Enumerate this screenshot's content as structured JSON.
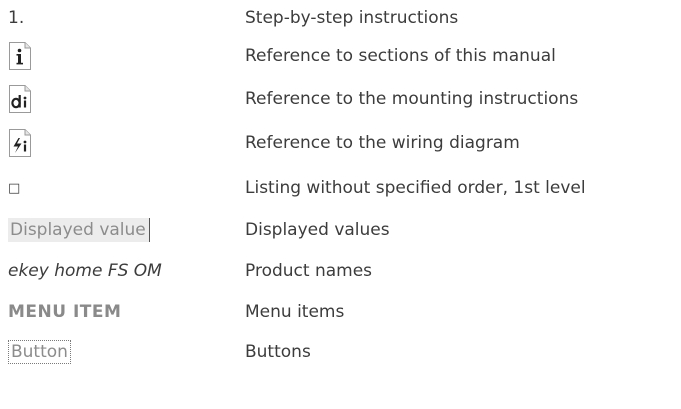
{
  "legend": {
    "rows": [
      {
        "symbol": "1.",
        "description": "Step-by-step instructions"
      },
      {
        "symbol_icon": "info-manual-icon",
        "description": "Reference to sections of this manual"
      },
      {
        "symbol_icon": "mounting-doc-icon",
        "description": "Reference to the mounting instructions"
      },
      {
        "symbol_icon": "wiring-doc-icon",
        "description": "Reference to the wiring diagram"
      },
      {
        "symbol": "□",
        "description": "Listing without specified order, 1st level"
      },
      {
        "symbol": "Displayed value",
        "description": "Displayed values"
      },
      {
        "symbol": "ekey home FS OM",
        "description": "Product names"
      },
      {
        "symbol": "MENU ITEM",
        "description": "Menu items"
      },
      {
        "symbol": "Button",
        "description": "Buttons"
      }
    ]
  }
}
